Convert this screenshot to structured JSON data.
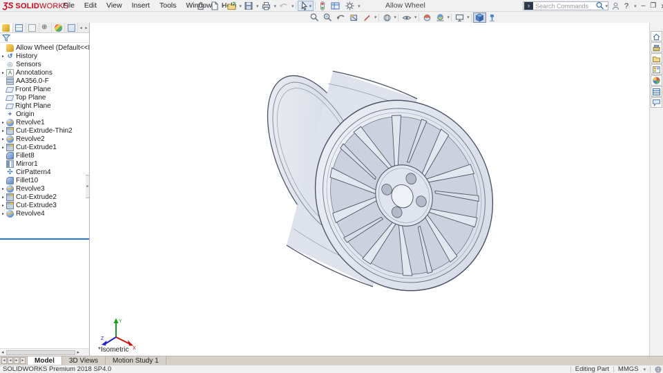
{
  "window": {
    "logo_ds": "ƷS",
    "logo_solid": "SOLID",
    "logo_works": "WORKS",
    "title": "Allow Wheel",
    "search_placeholder": "Search Commands",
    "search_chevron": "›",
    "help_label": "?",
    "minimize": "–",
    "restore": "❐",
    "close": "×"
  },
  "menus": [
    "File",
    "Edit",
    "View",
    "Insert",
    "Tools",
    "Window",
    "Help"
  ],
  "toolbar_icons": [
    "home",
    "new-document",
    "open",
    "save",
    "print",
    "undo",
    "select",
    "selection-filter",
    "xpert-tools",
    "options"
  ],
  "headsup_icons": [
    "zoom-to-fit",
    "zoom-to-area",
    "previous-view",
    "section-view",
    "dynamic-annotation-views",
    "display-style",
    "hide-show-items",
    "edit-appearance",
    "apply-scene",
    "view-settings",
    "view-cube",
    "pin"
  ],
  "taskpane_icons": [
    "solidworks-resources",
    "design-library",
    "file-explorer",
    "view-palette",
    "appearances-scenes",
    "custom-properties",
    "solidworks-forum"
  ],
  "feature_tree": {
    "tabs": [
      "featuremanager",
      "propertymanager",
      "configurationmanager",
      "dimxpertmanager",
      "displaymanager",
      "cam",
      "scroll-left",
      "scroll-right"
    ],
    "root": "Allow Wheel  (Default<<Default>_D",
    "items": [
      {
        "label": "History",
        "arrow": "▸"
      },
      {
        "label": "Sensors",
        "arrow": ""
      },
      {
        "label": "Annotations",
        "arrow": "▸"
      },
      {
        "label": "AA356.0-F",
        "arrow": ""
      },
      {
        "label": "Front Plane",
        "arrow": ""
      },
      {
        "label": "Top Plane",
        "arrow": ""
      },
      {
        "label": "Right Plane",
        "arrow": ""
      },
      {
        "label": "Origin",
        "arrow": ""
      },
      {
        "label": "Revolve1",
        "arrow": "▸"
      },
      {
        "label": "Cut-Extrude-Thin2",
        "arrow": "▸"
      },
      {
        "label": "Revolve2",
        "arrow": "▸"
      },
      {
        "label": "Cut-Extrude1",
        "arrow": "▸"
      },
      {
        "label": "Fillet8",
        "arrow": ""
      },
      {
        "label": "Mirror1",
        "arrow": ""
      },
      {
        "label": "CirPattern4",
        "arrow": ""
      },
      {
        "label": "Fillet10",
        "arrow": ""
      },
      {
        "label": "Revolve3",
        "arrow": "▸"
      },
      {
        "label": "Cut-Extrude2",
        "arrow": "▸"
      },
      {
        "label": "Cut-Extrude3",
        "arrow": "▸"
      },
      {
        "label": "Revolve4",
        "arrow": "▸"
      }
    ]
  },
  "viewport": {
    "view_label": "*Isometric",
    "axis_x": "X",
    "axis_y": "Y",
    "axis_z": "Z"
  },
  "doc_tabs": [
    "Model",
    "3D Views",
    "Motion Study 1"
  ],
  "statusbar": {
    "left": "SOLIDWORKS Premium 2018 SP4.0",
    "mode": "Editing Part",
    "units": "MMGS",
    "units_chevron": "▾"
  },
  "colors": {
    "accent_blue": "#2574db",
    "logo_red": "#d0021b",
    "model_fill": "#dde2ec",
    "model_line": "#4a5264"
  }
}
